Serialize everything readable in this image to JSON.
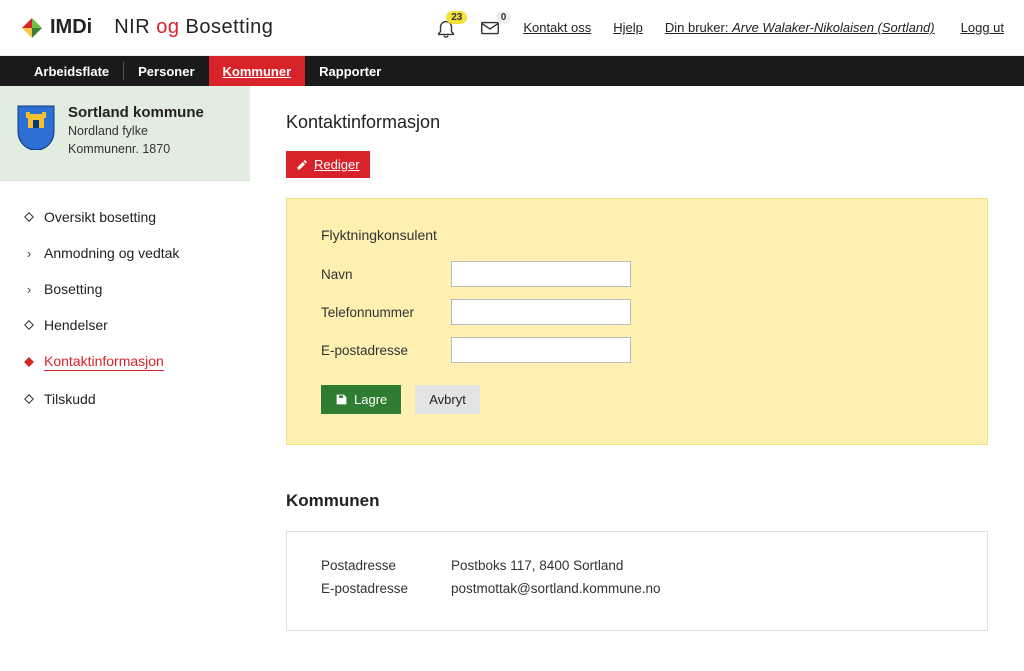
{
  "header": {
    "brand": "IMDi",
    "app_name_pre": "NIR ",
    "app_name_og": "og",
    "app_name_post": " Bosetting",
    "bell_count": "23",
    "mail_count": "0",
    "contact": "Kontakt oss",
    "help": "Hjelp",
    "user_prefix": "Din bruker: ",
    "user_name": "Arve Walaker-Nikolaisen (Sortland)",
    "logout": "Logg ut"
  },
  "nav": {
    "arbeidsflate": "Arbeidsflate",
    "personer": "Personer",
    "kommuner": "Kommuner",
    "rapporter": "Rapporter"
  },
  "sidebar": {
    "kommune_name": "Sortland kommune",
    "fylke": "Nordland fylke",
    "kommunenr": "Kommunenr. 1870",
    "items": {
      "oversikt": "Oversikt bosetting",
      "anmodning": "Anmodning og vedtak",
      "bosetting": "Bosetting",
      "hendelser": "Hendelser",
      "kontakt": "Kontaktinformasjon",
      "tilskudd": "Tilskudd"
    }
  },
  "main": {
    "title": "Kontaktinformasjon",
    "edit_label": "Rediger",
    "panel_heading": "Flyktningkonsulent",
    "labels": {
      "navn": "Navn",
      "telefon": "Telefonnummer",
      "epost": "E-postadresse"
    },
    "values": {
      "navn": "",
      "telefon": "",
      "epost": ""
    },
    "save": "Lagre",
    "cancel": "Avbryt",
    "kommune_title": "Kommunen",
    "kommune_info": {
      "postadresse_label": "Postadresse",
      "postadresse_value": "Postboks 117, 8400 Sortland",
      "epost_label": "E-postadresse",
      "epost_value": "postmottak@sortland.kommune.no"
    }
  }
}
